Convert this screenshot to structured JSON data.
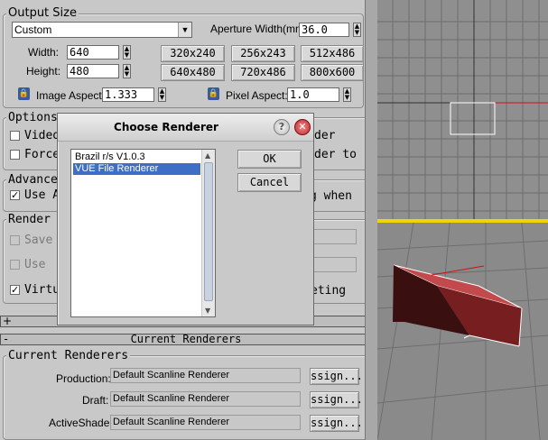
{
  "output_size": {
    "title": "Output Size",
    "preset": "Custom",
    "aperture_label": "Aperture Width(mm):",
    "aperture_value": "36.0",
    "width_label": "Width:",
    "width_value": "640",
    "height_label": "Height:",
    "height_value": "480",
    "presets": [
      "320x240",
      "256x243",
      "512x486",
      "640x480",
      "720x486",
      "800x600"
    ],
    "image_aspect_label": "Image Aspect:",
    "image_aspect_value": "1.333",
    "pixel_aspect_label": "Pixel Aspect:",
    "pixel_aspect_value": "1.0"
  },
  "options": {
    "title": "Options",
    "video": "Video",
    "force": "Force",
    "render_right": "der",
    "render_to": "der to"
  },
  "advanced": {
    "title": "Advanced",
    "use_a": "Use A",
    "g_when": "g when"
  },
  "render_output": {
    "title": "Render O",
    "save": "Save",
    "use": "Use",
    "virtu": "Virtu",
    "eting": "eting"
  },
  "current_renderers": {
    "rollout_title": "Current Renderers",
    "group_title": "Current Renderers",
    "rows": [
      {
        "label": "Production:",
        "value": "Default Scanline Renderer",
        "button": "ssign..."
      },
      {
        "label": "Draft:",
        "value": "Default Scanline Renderer",
        "button": "ssign..."
      },
      {
        "label": "ActiveShade:",
        "value": "Default Scanline Renderer",
        "button": "ssign..."
      }
    ]
  },
  "rollout_plus": "+",
  "rollout_minus": "-",
  "dialog": {
    "title": "Choose Renderer",
    "help_icon_glyph": "?",
    "close_icon_glyph": "✕",
    "items": [
      "Brazil r/s V1.0.3",
      "VUE File Renderer"
    ],
    "selected_index": 1,
    "ok": "OK",
    "cancel": "Cancel"
  },
  "colors": {
    "selection": "#3d6fc4",
    "active_viewport_border": "#f1d500",
    "box_red": "#c0393b",
    "grid_red_axis": "#d01010"
  }
}
